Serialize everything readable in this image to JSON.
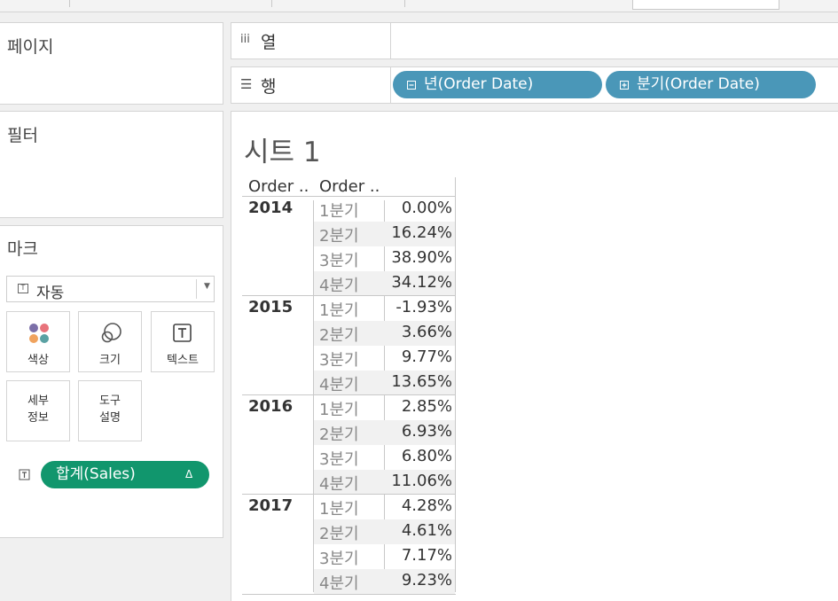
{
  "panels": {
    "pages_title": "페이지",
    "filters_title": "필터",
    "marks_title": "마크"
  },
  "marks": {
    "mark_type": "자동",
    "buttons": {
      "color": "색상",
      "size": "크기",
      "text": "텍스트",
      "detail_line1": "세부",
      "detail_line2": "정보",
      "tooltip_line1": "도구",
      "tooltip_line2": "설명"
    },
    "text_pill": {
      "label": "합계(Sales)",
      "delta_icon": "Δ"
    }
  },
  "shelves": {
    "columns_label": "열",
    "rows_label": "행",
    "row_pills": [
      "년(Order Date)",
      "분기(Order Date)"
    ]
  },
  "sheet": {
    "title": "시트 1",
    "col_headers": [
      "Order ..",
      "Order .."
    ],
    "quarter_labels": [
      "1분기",
      "2분기",
      "3분기",
      "4분기"
    ],
    "years": [
      {
        "year": "2014",
        "values": [
          "0.00%",
          "16.24%",
          "38.90%",
          "34.12%"
        ]
      },
      {
        "year": "2015",
        "values": [
          "-1.93%",
          "3.66%",
          "9.77%",
          "13.65%"
        ]
      },
      {
        "year": "2016",
        "values": [
          "2.85%",
          "6.93%",
          "6.80%",
          "11.06%"
        ]
      },
      {
        "year": "2017",
        "values": [
          "4.28%",
          "4.61%",
          "7.17%",
          "9.23%"
        ]
      }
    ]
  },
  "colors": {
    "dimension_pill": "#4a97b8",
    "measure_pill": "#11966d"
  }
}
